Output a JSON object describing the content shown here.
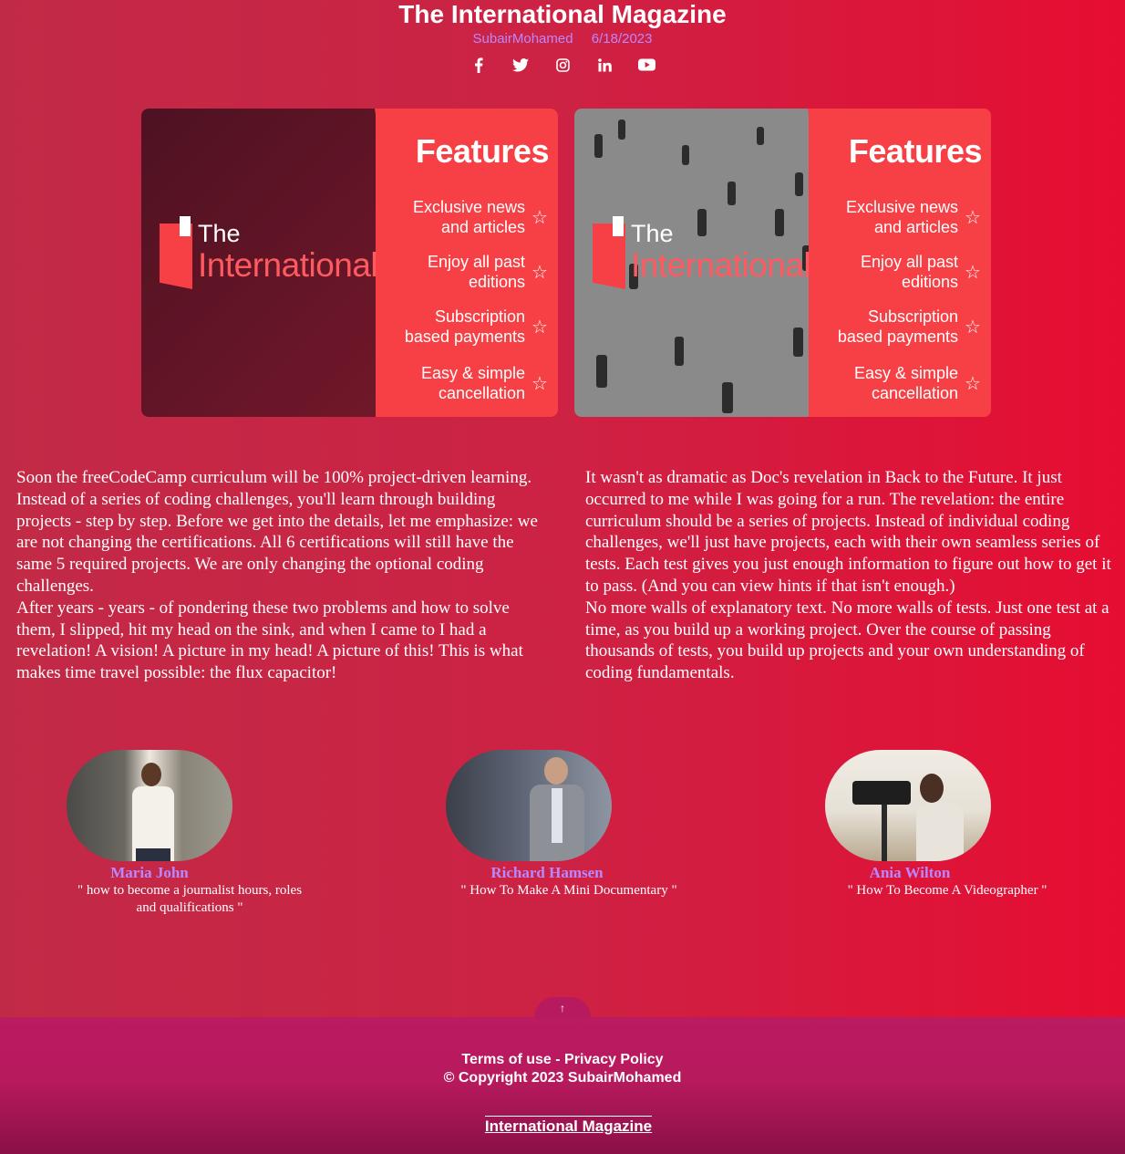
{
  "header": {
    "title": "The International Magazine",
    "author": "SubairMohamed",
    "date": "6/18/2023",
    "socials": [
      "facebook-icon",
      "twitter-icon",
      "instagram-icon",
      "linkedin-icon",
      "youtube-icon"
    ]
  },
  "banners": [
    {
      "logo_the": "The",
      "logo_name": "International",
      "features_title": "Features",
      "features": [
        "Exclusive news\nand articles",
        "Enjoy all past\neditions",
        "Subscription\nbased payments",
        "Easy & simple\ncancellation"
      ]
    },
    {
      "logo_the": "The",
      "logo_name": "International",
      "features_title": "Features",
      "features": [
        "Exclusive news\nand articles",
        "Enjoy all past\neditions",
        "Subscription\nbased payments",
        "Easy & simple\ncancellation"
      ]
    }
  ],
  "articles": [
    {
      "p1": "Soon the freeCodeCamp curriculum will be 100% project-driven learning. Instead of a series of coding challenges, you'll learn through building projects - step by step. Before we get into the details, let me emphasize: we are not changing the certifications. All 6 certifications will still have the same 5 required projects. We are only changing the optional coding challenges.",
      "p2": "After years - years - of pondering these two problems and how to solve them, I slipped, hit my head on the sink, and when I came to I had a revelation! A vision! A picture in my head! A picture of this! This is what makes time travel possible: the flux capacitor!"
    },
    {
      "p1": "It wasn't as dramatic as Doc's revelation in Back to the Future. It just occurred to me while I was going for a run. The revelation: the entire curriculum should be a series of projects. Instead of individual coding challenges, we'll just have projects, each with their own seamless series of tests. Each test gives you just enough information to figure out how to get it to pass. (And you can view hints if that isn't enough.)",
      "p2": "No more walls of explanatory text. No more walls of tests. Just one test at a time, as you build up a working project. Over the course of passing thousands of tests, you build up projects and your own understanding of coding fundamentals."
    }
  ],
  "authors": [
    {
      "name": "Maria John",
      "quote": "\" how to become a journalist hours, roles\nand qualifications \""
    },
    {
      "name": "Richard Hamsen",
      "quote": "\" How To Make A Mini Documentary \""
    },
    {
      "name": "Ania Wilton",
      "quote": "\" How To Become A Videographer \""
    }
  ],
  "footer": {
    "back_to_top": "↑",
    "terms": "Terms of use",
    "separator": " - ",
    "privacy": "Privacy Policy",
    "copyright": "© Copyright 2023 SubairMohamed",
    "brand": "International Magazine"
  },
  "colors": {
    "accent_purple": "#b987ff",
    "banner_red": "#f74045",
    "footer": "#bb1b61"
  }
}
